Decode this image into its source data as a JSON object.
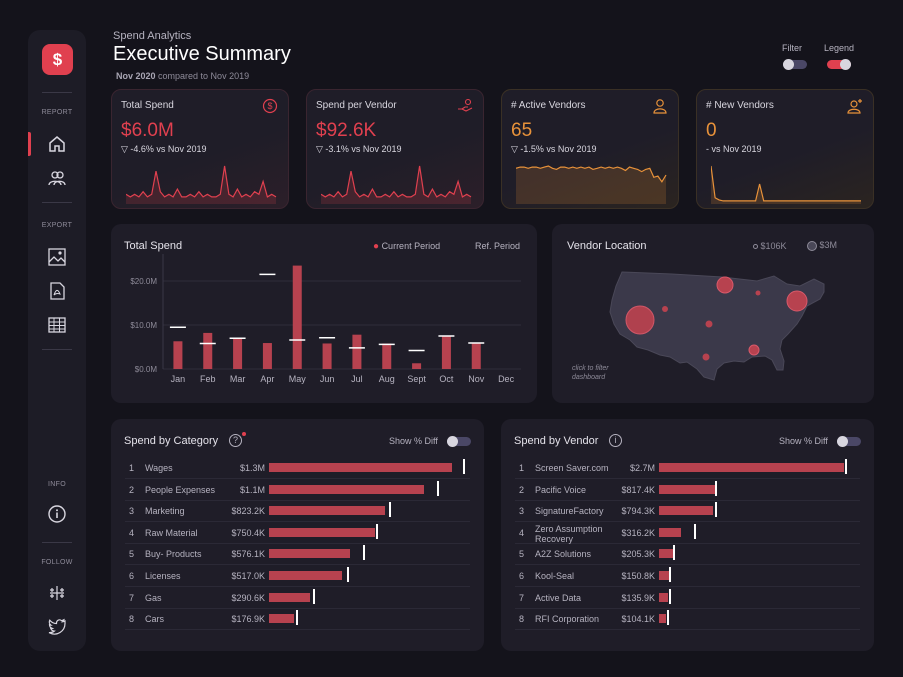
{
  "header": {
    "subtitle": "Spend Analytics",
    "title": "Executive Summary",
    "period_bold": "Nov 2020",
    "period_rest": " compared to Nov 2019",
    "filter_label": "Filter",
    "legend_label": "Legend"
  },
  "sidebar": {
    "report_label": "REPORT",
    "export_label": "EXPORT",
    "info_label": "INFO",
    "follow_label": "FOLLOW",
    "logo_glyph": "$"
  },
  "kpis": [
    {
      "title": "Total Spend",
      "value": "$6.0M",
      "delta": "▽ -4.6% vs Nov 2019",
      "color": "#e0404f",
      "icon": "dollar-circle-icon",
      "spark": [
        3,
        2,
        3,
        2,
        4,
        2,
        3,
        12,
        4,
        2,
        3,
        2,
        5,
        2,
        2,
        3,
        2,
        4,
        2,
        3,
        2,
        2,
        3,
        14,
        3,
        2,
        5,
        2,
        3,
        2,
        4,
        3,
        8,
        2,
        3,
        2
      ]
    },
    {
      "title": "Spend per Vendor",
      "value": "$92.6K",
      "delta": "▽ -3.1% vs Nov 2019",
      "color": "#e0404f",
      "icon": "hand-money-icon",
      "spark": [
        3,
        2,
        3,
        2,
        4,
        2,
        3,
        12,
        4,
        2,
        3,
        2,
        5,
        2,
        2,
        3,
        2,
        4,
        2,
        3,
        2,
        2,
        3,
        14,
        3,
        2,
        5,
        2,
        3,
        2,
        4,
        3,
        8,
        2,
        3,
        2
      ]
    },
    {
      "title": "# Active Vendors",
      "value": "65",
      "delta": "▽ -1.5% vs Nov 2019",
      "color": "#e8923a",
      "icon": "user-icon",
      "spark": [
        30,
        31,
        31,
        30,
        31,
        31,
        30,
        31,
        32,
        30,
        29,
        31,
        31,
        30,
        31,
        30,
        31,
        30,
        31,
        29,
        30,
        31,
        30,
        31,
        30,
        31,
        30,
        28,
        31,
        30,
        29,
        27,
        29,
        30,
        22,
        23,
        18,
        24
      ]
    },
    {
      "title": "# New Vendors",
      "value": "0",
      "delta": "- vs Nov 2019",
      "color": "#e8923a",
      "icon": "user-plus-icon",
      "spark": [
        34,
        4,
        2,
        1,
        1,
        1,
        1,
        1,
        1,
        1,
        1,
        1,
        17,
        1,
        1,
        1,
        1,
        1,
        1,
        1,
        1,
        1,
        1,
        1,
        1,
        1,
        1,
        1,
        1,
        1,
        1,
        1,
        1,
        1,
        1,
        1,
        1,
        1
      ]
    }
  ],
  "total_spend": {
    "title": "Total Spend",
    "legend_current": "Current Period",
    "legend_ref": "Ref. Period",
    "accent": "#b7424f"
  },
  "chart_data": {
    "type": "bar",
    "title": "Total Spend",
    "categories": [
      "Jan",
      "Feb",
      "Mar",
      "Apr",
      "May",
      "Jun",
      "Jul",
      "Aug",
      "Sept",
      "Oct",
      "Nov",
      "Dec"
    ],
    "series": [
      {
        "name": "Current Period",
        "values": [
          6.3,
          8.2,
          7.0,
          5.9,
          23.5,
          5.8,
          7.8,
          5.8,
          1.3,
          7.6,
          6.0,
          0
        ]
      },
      {
        "name": "Ref. Period",
        "values": [
          9.5,
          5.8,
          7.0,
          21.5,
          6.6,
          7.1,
          4.8,
          5.6,
          4.2,
          7.5,
          5.9,
          null
        ]
      }
    ],
    "yticks": [
      "$0.0M",
      "$10.0M",
      "$20.0M"
    ],
    "ylim": [
      0,
      25
    ]
  },
  "vendor_location": {
    "title": "Vendor Location",
    "legend_small": "$106K",
    "legend_large": "$3M",
    "hint_line1": "click to filter",
    "hint_line2": "dashboard"
  },
  "category": {
    "title": "Spend by Category",
    "toggle_label": "Show % Diff",
    "max": 1.3,
    "rows": [
      {
        "rank": "1",
        "name": "Wages",
        "value": "$1.3M",
        "amount": 1.3,
        "ref": 1.38
      },
      {
        "rank": "2",
        "name": "People Expenses",
        "value": "$1.1M",
        "amount": 1.1,
        "ref": 1.19
      },
      {
        "rank": "3",
        "name": "Marketing",
        "value": "$823.2K",
        "amount": 0.8232,
        "ref": 0.85
      },
      {
        "rank": "4",
        "name": "Raw Material",
        "value": "$750.4K",
        "amount": 0.7504,
        "ref": 0.76
      },
      {
        "rank": "5",
        "name": "Buy- Products",
        "value": "$576.1K",
        "amount": 0.5761,
        "ref": 0.67
      },
      {
        "rank": "6",
        "name": "Licenses",
        "value": "$517.0K",
        "amount": 0.517,
        "ref": 0.55
      },
      {
        "rank": "7",
        "name": "Gas",
        "value": "$290.6K",
        "amount": 0.2906,
        "ref": 0.31
      },
      {
        "rank": "8",
        "name": "Cars",
        "value": "$176.9K",
        "amount": 0.1769,
        "ref": 0.19
      }
    ]
  },
  "vendor": {
    "title": "Spend by Vendor",
    "toggle_label": "Show % Diff",
    "max": 2.7,
    "rows": [
      {
        "rank": "1",
        "name": "Screen Saver.com",
        "value": "$2.7M",
        "amount": 2.7,
        "ref": 2.72
      },
      {
        "rank": "2",
        "name": "Pacific Voice",
        "value": "$817.4K",
        "amount": 0.8174,
        "ref": 0.82
      },
      {
        "rank": "3",
        "name": "SignatureFactory",
        "value": "$794.3K",
        "amount": 0.7943,
        "ref": 0.81
      },
      {
        "rank": "4",
        "name": "Zero Assumption Recovery",
        "value": "$316.2K",
        "amount": 0.3162,
        "ref": 0.51
      },
      {
        "rank": "5",
        "name": "A2Z Solutions",
        "value": "$205.3K",
        "amount": 0.2053,
        "ref": 0.21
      },
      {
        "rank": "6",
        "name": "Kool-Seal",
        "value": "$150.8K",
        "amount": 0.1508,
        "ref": 0.15
      },
      {
        "rank": "7",
        "name": "Active Data",
        "value": "$135.9K",
        "amount": 0.1359,
        "ref": 0.14
      },
      {
        "rank": "8",
        "name": "RFI Corporation",
        "value": "$104.1K",
        "amount": 0.1041,
        "ref": 0.11
      }
    ]
  }
}
